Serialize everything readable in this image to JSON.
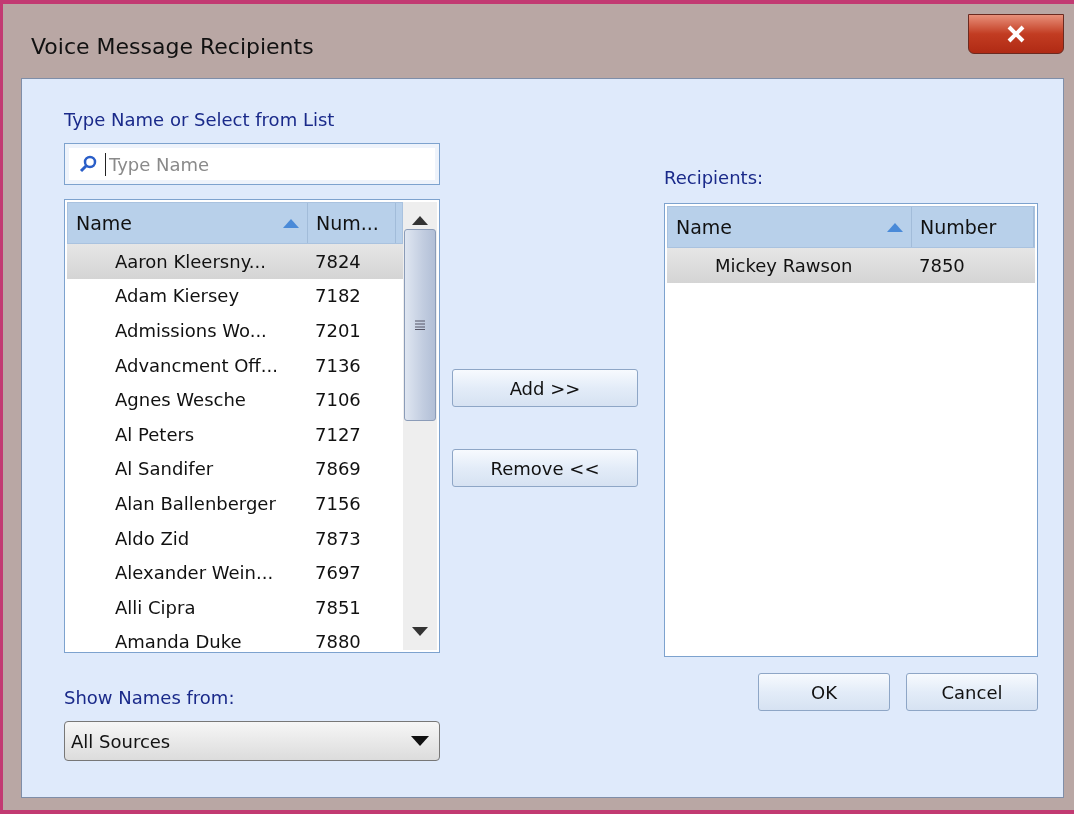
{
  "window": {
    "title": "Voice Message Recipients"
  },
  "search": {
    "label": "Type Name or Select from List",
    "placeholder": "Type Name"
  },
  "directory": {
    "columns": [
      {
        "label": "Name",
        "sorted": true
      },
      {
        "label": "Num...",
        "sorted": false
      }
    ],
    "rows": [
      {
        "name": "Aaron Kleersny...",
        "number": "7824",
        "selected": true
      },
      {
        "name": "Adam Kiersey",
        "number": "7182",
        "selected": false
      },
      {
        "name": "Admissions Wo...",
        "number": "7201",
        "selected": false
      },
      {
        "name": "Advancment Off...",
        "number": "7136",
        "selected": false
      },
      {
        "name": "Agnes Wesche",
        "number": "7106",
        "selected": false
      },
      {
        "name": "Al Peters",
        "number": "7127",
        "selected": false
      },
      {
        "name": "Al Sandifer",
        "number": "7869",
        "selected": false
      },
      {
        "name": "Alan Ballenberger",
        "number": "7156",
        "selected": false
      },
      {
        "name": "Aldo Zid",
        "number": "7873",
        "selected": false
      },
      {
        "name": "Alexander Wein...",
        "number": "7697",
        "selected": false
      },
      {
        "name": "Alli Cipra",
        "number": "7851",
        "selected": false
      },
      {
        "name": "Amanda Duke",
        "number": "7880",
        "selected": false
      }
    ]
  },
  "actions": [
    "Add >>",
    "Remove <<"
  ],
  "recipients": {
    "label": "Recipients:",
    "columns": [
      {
        "label": "Name",
        "sorted": true
      },
      {
        "label": "Number",
        "sorted": false
      }
    ],
    "rows": [
      {
        "name": "Mickey Rawson",
        "number": "7850",
        "selected": true
      }
    ]
  },
  "source": {
    "label": "Show Names from:",
    "value": "All Sources"
  },
  "buttons": [
    "OK",
    "Cancel"
  ]
}
